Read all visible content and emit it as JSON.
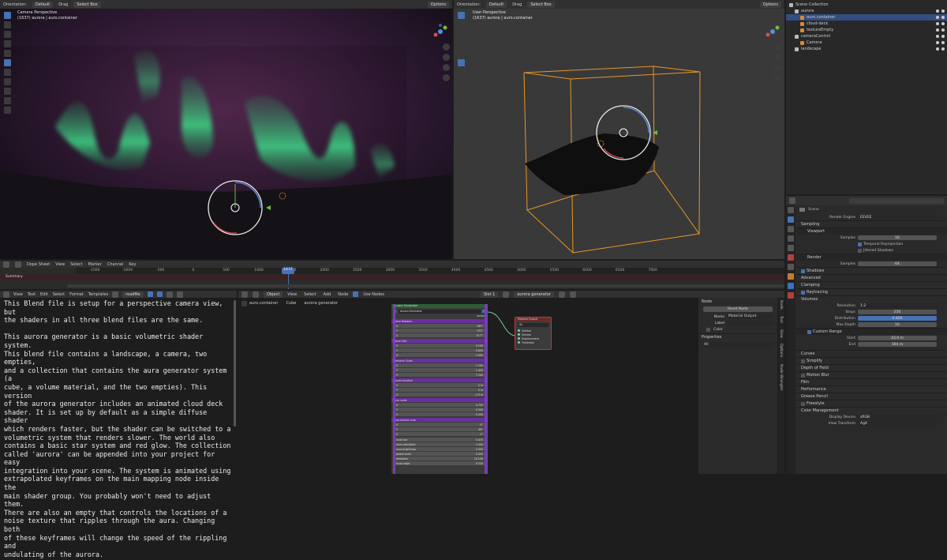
{
  "viewport_left": {
    "orientation_label": "Orientation:",
    "orientation_value": "Default",
    "drag_label": "Drag",
    "select_mode": "Select Box",
    "options": "Options",
    "title": "Camera Perspective",
    "subtitle": "(1637) aurora | auro.container"
  },
  "viewport_right": {
    "orientation_label": "Orientation:",
    "orientation_value": "Default",
    "drag_label": "Drag",
    "select_mode": "Select Box",
    "options": "Options",
    "title": "User Perspective",
    "subtitle": "(1637) aurora | auro.container"
  },
  "outliner": {
    "items": [
      {
        "label": "Scene Collection",
        "indent": 0,
        "selected": false
      },
      {
        "label": "aurora",
        "indent": 1,
        "selected": false
      },
      {
        "label": "auro.container",
        "indent": 2,
        "selected": true
      },
      {
        "label": "cloud-deck",
        "indent": 2,
        "selected": false
      },
      {
        "label": "textureEmpty",
        "indent": 2,
        "selected": false
      },
      {
        "label": "cameraControl",
        "indent": 1,
        "selected": false
      },
      {
        "label": "Camera",
        "indent": 2,
        "selected": false
      },
      {
        "label": "landscape",
        "indent": 1,
        "selected": false
      }
    ]
  },
  "properties": {
    "scene_label": "Scene",
    "render_engine_label": "Render Engine",
    "render_engine": "EEVEE",
    "sections": {
      "sampling": "Sampling",
      "viewport": "Viewport",
      "render": "Render",
      "clamping": "Clamping",
      "raytracing": "Raytracing",
      "volumes": "Volumes",
      "curves": "Curves",
      "simplify": "Simplify",
      "dof": "Depth of Field",
      "motion_blur": "Motion Blur",
      "film": "Film",
      "performance": "Performance",
      "grease_pencil": "Grease Pencil",
      "freestyle": "Freestyle",
      "color_management": "Color Management"
    },
    "samples_label": "Samples",
    "viewport_samples": "16",
    "render_samples": "64",
    "temporal_reprojection": "Temporal Reprojection",
    "jittered_shadows": "Jittered Shadows",
    "shadows": "Shadows",
    "advanced": "Advanced",
    "resolution_label": "Resolution",
    "resolution": "1:2",
    "steps_label": "Steps",
    "steps": "256",
    "distribution_label": "Distribution",
    "distribution": "0.800",
    "max_depth_label": "Max Depth",
    "max_depth": "16",
    "custom_range": "Custom Range",
    "start_label": "Start",
    "start": "43.9 m",
    "end_label": "End",
    "end": "304 m",
    "display_device_label": "Display Device",
    "display_device": "sRGB",
    "view_transform_label": "View Transform",
    "view_transform": "AgX"
  },
  "dopesheet": {
    "mode": "Dope Sheet",
    "menus": [
      "View",
      "Select",
      "Marker",
      "Channel",
      "Key"
    ],
    "summary": "Summary",
    "current_frame": "1637",
    "ticks": [
      "-1500",
      "-1000",
      "-500",
      "0",
      "500",
      "1000",
      "1500",
      "2000",
      "2500",
      "3000",
      "3500",
      "4000",
      "4500",
      "5000",
      "5500",
      "6000",
      "6500",
      "7000"
    ]
  },
  "text_editor": {
    "menus": [
      "View",
      "Text",
      "Edit",
      "Select",
      "Format",
      "Templates"
    ],
    "filename": "readMe",
    "body": "This Blend file is setup for a perspective camera view, but\nthe shaders in all three blend files are the same.\n\nThis aurora generator is a basic volumetric shader system.\nThis blend file contains a landscape, a camera, two empties,\nand a collection that contains the aura generator system (a\ncube, a volume material, and the two empties). This version\nof the aurora generator includes an animated cloud deck\nshader. It is set up by default as a simple diffuse shader\nwhich renders faster, but the shader can be switched to a\nvolumetric system that renders slower. The world also\ncontains a basic star system and red glow. The collection\ncalled 'aurora' can be appended into your project for easy\nintegration into your scene. The system is animated using\nextrapolated keyframes on the main mapping node inside the\nmain shader group. You probably won't need to adjust them.\nThere are also an empty that controls the locations of a\nnoise texture that ripples through the aura. Changing both\nof these keyframes will change the speed of the rippling and\nundulating of the aurora."
  },
  "node_editor": {
    "object_mode": "Object",
    "menus": [
      "View",
      "Select",
      "Add",
      "Node"
    ],
    "use_nodes": "Use Nodes",
    "slot": "Slot 1",
    "material": "aurora generator",
    "breadcrumb": [
      "auro.container",
      "Cube",
      "aurora generator"
    ],
    "group_node": {
      "title": "Aurora Generator",
      "dropdown": "Aurora Generator",
      "output_label": "output",
      "groups": [
        {
          "name": "Noise Rotation",
          "fields": [
            [
              "X",
              "260°"
            ],
            [
              "Y",
              "372°"
            ],
            [
              "Z",
              "15.7°"
            ]
          ]
        },
        {
          "name": "Noise Size",
          "fields": [
            [
              "X",
              "0.100"
            ],
            [
              "Y",
              "0.800"
            ],
            [
              "Z",
              "1.000"
            ]
          ]
        },
        {
          "name": "Emission Scale",
          "fields": [
            [
              "X",
              "1.700"
            ],
            [
              "Y",
              "1.400"
            ],
            [
              "Z",
              "7.200"
            ]
          ]
        },
        {
          "name": "aurora location",
          "fields": [
            [
              "X",
              "0 m"
            ],
            [
              "Y",
              "0 m"
            ],
            [
              "Z",
              "-2.5 m"
            ]
          ]
        },
        {
          "name": "aura scale",
          "fields": [
            [
              "X",
              "0.700"
            ],
            [
              "Y",
              "0.300"
            ],
            [
              "Z",
              "0.300"
            ]
          ]
        },
        {
          "name": "aura bottom crop",
          "fields": [
            [
              "X",
              "0°"
            ],
            [
              "Y",
              "90°"
            ],
            [
              "Z",
              "0°"
            ]
          ]
        }
      ],
      "params": [
        [
          "aura hue",
          "0.470"
        ],
        [
          "aura saturation",
          "1.000"
        ],
        [
          "aura brightness",
          "0.050"
        ],
        [
          "global scale",
          "0.050"
        ],
        [
          "distortion",
          "10.100"
        ],
        [
          "fuzzy edge",
          "0.320"
        ]
      ]
    },
    "output_node": {
      "title": "Material Output",
      "target": "All",
      "sockets": [
        "Surface",
        "Volume",
        "Displacement",
        "Thickness"
      ]
    },
    "side": {
      "node_heading": "Node",
      "reset_node": "Reset Node",
      "name_label": "Name",
      "name_value": "Material Output",
      "label_label": "Label",
      "color_heading": "Color",
      "properties_heading": "Properties",
      "target": "All",
      "tabs": [
        "Node",
        "Tool",
        "View",
        "Options",
        "Node Wrangler"
      ]
    }
  }
}
